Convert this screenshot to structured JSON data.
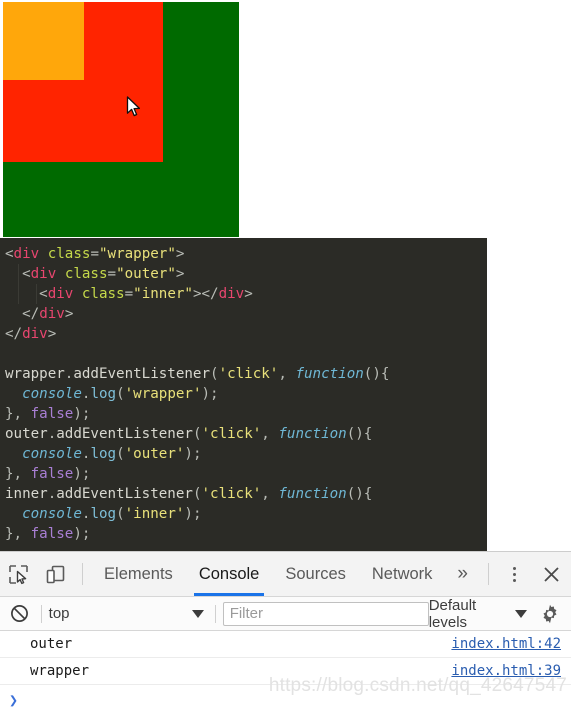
{
  "demo": {
    "boxes": [
      {
        "name": "wrapper",
        "color": "#006a00"
      },
      {
        "name": "outer",
        "color": "#ff2400"
      },
      {
        "name": "inner",
        "color": "#ffa70b"
      }
    ],
    "cursor_icon": "arrow-pointer"
  },
  "code": {
    "html_lines": [
      "<div class=\"wrapper\">",
      "  <div class=\"outer\">",
      "    <div class=\"inner\"></div>",
      "  </div>",
      "</div>"
    ],
    "js_lines": [
      "wrapper.addEventListener('click', function(){",
      "  console.log('wrapper');",
      "}, false);",
      "outer.addEventListener('click', function(){",
      "  console.log('outer');",
      "}, false);",
      "inner.addEventListener('click', function(){",
      "  console.log('inner');",
      "}, false);"
    ]
  },
  "devtools": {
    "left_icons": [
      {
        "name": "inspect-element-icon",
        "title": "Inspect"
      },
      {
        "name": "device-toolbar-icon",
        "title": "Toggle device toolbar"
      }
    ],
    "tabs": [
      {
        "label": "Elements",
        "active": false
      },
      {
        "label": "Console",
        "active": true
      },
      {
        "label": "Sources",
        "active": false
      },
      {
        "label": "Network",
        "active": false
      }
    ],
    "more_tabs_label": "»",
    "kebab_icon": "more-options-icon",
    "close_icon": "close-icon",
    "accent_color": "#1a73e8"
  },
  "console_toolbar": {
    "clear_icon": "clear-console-icon",
    "context": {
      "value": "top",
      "caret": "▼"
    },
    "filter": {
      "value": "",
      "placeholder": "Filter"
    },
    "levels": {
      "value": "Default levels",
      "caret": "▼"
    },
    "settings_icon": "gear-icon"
  },
  "console": {
    "messages": [
      {
        "text": "outer",
        "source": "index.html:42"
      },
      {
        "text": "wrapper",
        "source": "index.html:39"
      }
    ],
    "prompt_symbol": "❯"
  },
  "watermark": {
    "text": "https://blog.csdn.net/qq_42647547"
  }
}
